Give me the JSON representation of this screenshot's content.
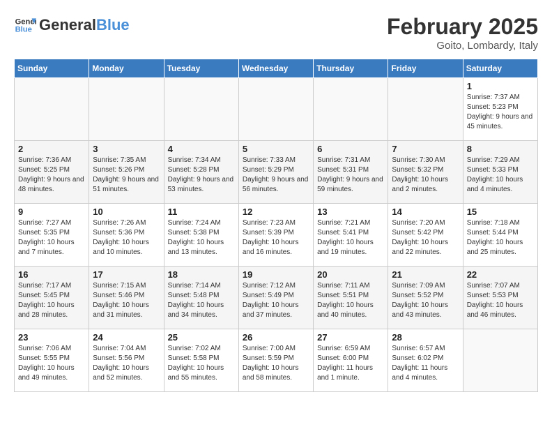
{
  "header": {
    "logo_general": "General",
    "logo_blue": "Blue",
    "month_title": "February 2025",
    "location": "Goito, Lombardy, Italy"
  },
  "weekdays": [
    "Sunday",
    "Monday",
    "Tuesday",
    "Wednesday",
    "Thursday",
    "Friday",
    "Saturday"
  ],
  "weeks": [
    [
      {
        "day": "",
        "info": ""
      },
      {
        "day": "",
        "info": ""
      },
      {
        "day": "",
        "info": ""
      },
      {
        "day": "",
        "info": ""
      },
      {
        "day": "",
        "info": ""
      },
      {
        "day": "",
        "info": ""
      },
      {
        "day": "1",
        "info": "Sunrise: 7:37 AM\nSunset: 5:23 PM\nDaylight: 9 hours and 45 minutes."
      }
    ],
    [
      {
        "day": "2",
        "info": "Sunrise: 7:36 AM\nSunset: 5:25 PM\nDaylight: 9 hours and 48 minutes."
      },
      {
        "day": "3",
        "info": "Sunrise: 7:35 AM\nSunset: 5:26 PM\nDaylight: 9 hours and 51 minutes."
      },
      {
        "day": "4",
        "info": "Sunrise: 7:34 AM\nSunset: 5:28 PM\nDaylight: 9 hours and 53 minutes."
      },
      {
        "day": "5",
        "info": "Sunrise: 7:33 AM\nSunset: 5:29 PM\nDaylight: 9 hours and 56 minutes."
      },
      {
        "day": "6",
        "info": "Sunrise: 7:31 AM\nSunset: 5:31 PM\nDaylight: 9 hours and 59 minutes."
      },
      {
        "day": "7",
        "info": "Sunrise: 7:30 AM\nSunset: 5:32 PM\nDaylight: 10 hours and 2 minutes."
      },
      {
        "day": "8",
        "info": "Sunrise: 7:29 AM\nSunset: 5:33 PM\nDaylight: 10 hours and 4 minutes."
      }
    ],
    [
      {
        "day": "9",
        "info": "Sunrise: 7:27 AM\nSunset: 5:35 PM\nDaylight: 10 hours and 7 minutes."
      },
      {
        "day": "10",
        "info": "Sunrise: 7:26 AM\nSunset: 5:36 PM\nDaylight: 10 hours and 10 minutes."
      },
      {
        "day": "11",
        "info": "Sunrise: 7:24 AM\nSunset: 5:38 PM\nDaylight: 10 hours and 13 minutes."
      },
      {
        "day": "12",
        "info": "Sunrise: 7:23 AM\nSunset: 5:39 PM\nDaylight: 10 hours and 16 minutes."
      },
      {
        "day": "13",
        "info": "Sunrise: 7:21 AM\nSunset: 5:41 PM\nDaylight: 10 hours and 19 minutes."
      },
      {
        "day": "14",
        "info": "Sunrise: 7:20 AM\nSunset: 5:42 PM\nDaylight: 10 hours and 22 minutes."
      },
      {
        "day": "15",
        "info": "Sunrise: 7:18 AM\nSunset: 5:44 PM\nDaylight: 10 hours and 25 minutes."
      }
    ],
    [
      {
        "day": "16",
        "info": "Sunrise: 7:17 AM\nSunset: 5:45 PM\nDaylight: 10 hours and 28 minutes."
      },
      {
        "day": "17",
        "info": "Sunrise: 7:15 AM\nSunset: 5:46 PM\nDaylight: 10 hours and 31 minutes."
      },
      {
        "day": "18",
        "info": "Sunrise: 7:14 AM\nSunset: 5:48 PM\nDaylight: 10 hours and 34 minutes."
      },
      {
        "day": "19",
        "info": "Sunrise: 7:12 AM\nSunset: 5:49 PM\nDaylight: 10 hours and 37 minutes."
      },
      {
        "day": "20",
        "info": "Sunrise: 7:11 AM\nSunset: 5:51 PM\nDaylight: 10 hours and 40 minutes."
      },
      {
        "day": "21",
        "info": "Sunrise: 7:09 AM\nSunset: 5:52 PM\nDaylight: 10 hours and 43 minutes."
      },
      {
        "day": "22",
        "info": "Sunrise: 7:07 AM\nSunset: 5:53 PM\nDaylight: 10 hours and 46 minutes."
      }
    ],
    [
      {
        "day": "23",
        "info": "Sunrise: 7:06 AM\nSunset: 5:55 PM\nDaylight: 10 hours and 49 minutes."
      },
      {
        "day": "24",
        "info": "Sunrise: 7:04 AM\nSunset: 5:56 PM\nDaylight: 10 hours and 52 minutes."
      },
      {
        "day": "25",
        "info": "Sunrise: 7:02 AM\nSunset: 5:58 PM\nDaylight: 10 hours and 55 minutes."
      },
      {
        "day": "26",
        "info": "Sunrise: 7:00 AM\nSunset: 5:59 PM\nDaylight: 10 hours and 58 minutes."
      },
      {
        "day": "27",
        "info": "Sunrise: 6:59 AM\nSunset: 6:00 PM\nDaylight: 11 hours and 1 minute."
      },
      {
        "day": "28",
        "info": "Sunrise: 6:57 AM\nSunset: 6:02 PM\nDaylight: 11 hours and 4 minutes."
      },
      {
        "day": "",
        "info": ""
      }
    ]
  ]
}
